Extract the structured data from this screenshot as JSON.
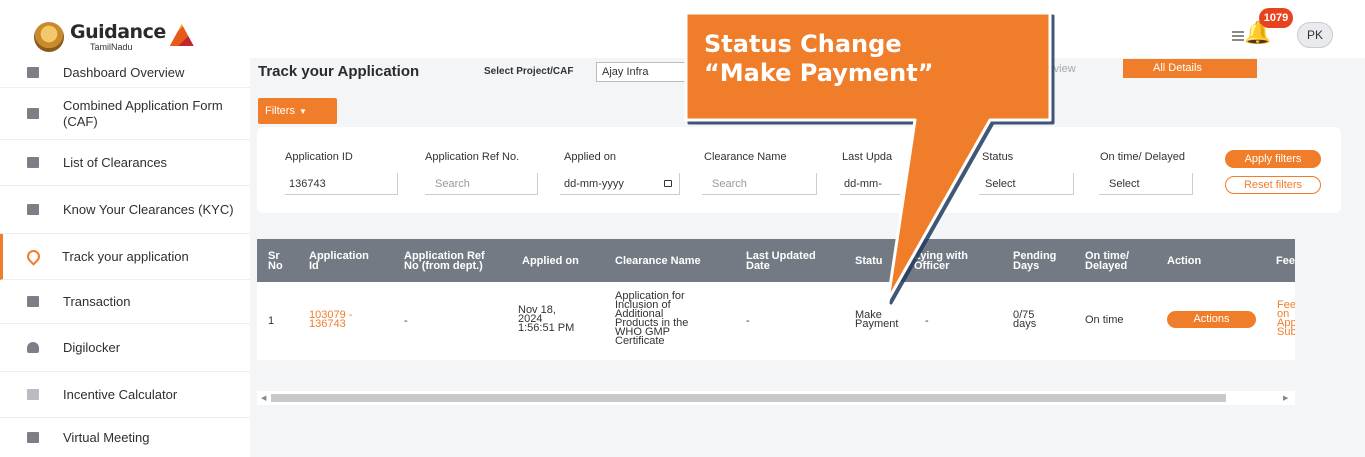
{
  "header": {
    "logo_title": "Guidance",
    "logo_subtitle": "TamilNadu",
    "notification_count": "1079",
    "user_initials": "PK"
  },
  "sidebar": {
    "items": [
      {
        "label": "Dashboard Overview",
        "icon": "dashboard-icon"
      },
      {
        "label": "Combined Application Form (CAF)",
        "icon": "document-icon"
      },
      {
        "label": "List of Clearances",
        "icon": "list-icon"
      },
      {
        "label": "Know Your Clearances (KYC)",
        "icon": "kyc-icon"
      },
      {
        "label": "Track your application",
        "icon": "location-pin-icon",
        "active": true
      },
      {
        "label": "Transaction",
        "icon": "transaction-icon"
      },
      {
        "label": "Digilocker",
        "icon": "cloud-icon"
      },
      {
        "label": "Incentive Calculator",
        "icon": "calculator-icon"
      },
      {
        "label": "Virtual Meeting",
        "icon": "meeting-icon"
      }
    ]
  },
  "main": {
    "title": "Track your Application",
    "project_label": "Select Project/CAF",
    "project_value": "Ajay Infra",
    "overview_tab": "rview",
    "all_details_tab": "All Details",
    "filters_label": "Filters"
  },
  "filters": {
    "application_id": {
      "label": "Application ID",
      "value": "136743"
    },
    "application_ref": {
      "label": "Application Ref No.",
      "placeholder": "Search"
    },
    "applied_on": {
      "label": "Applied on",
      "placeholder": "dd-mm-yyyy"
    },
    "clearance_name": {
      "label": "Clearance Name",
      "placeholder": "Search"
    },
    "last_updated": {
      "label": "Last Upda",
      "placeholder": "dd-mm-"
    },
    "status": {
      "label": "Status",
      "placeholder": "Select"
    },
    "on_time": {
      "label": "On time/ Delayed",
      "placeholder": "Select"
    },
    "apply_label": "Apply filters",
    "reset_label": "Reset filters"
  },
  "table": {
    "headers": [
      {
        "l1": "Sr",
        "l2": "No"
      },
      {
        "l1": "Application",
        "l2": "Id"
      },
      {
        "l1": "Application Ref",
        "l2": "No (from dept.)"
      },
      {
        "l1": "Applied on",
        "l2": ""
      },
      {
        "l1": "Clearance Name",
        "l2": ""
      },
      {
        "l1": "Last Updated",
        "l2": "Date"
      },
      {
        "l1": "Statu",
        "l2": ""
      },
      {
        "l1": "Lying with",
        "l2": "Officer"
      },
      {
        "l1": "Pending",
        "l2": "Days"
      },
      {
        "l1": "On time/",
        "l2": "Delayed"
      },
      {
        "l1": "Action",
        "l2": ""
      },
      {
        "l1": "Fee",
        "l2": ""
      }
    ],
    "row": {
      "sr": "1",
      "app_id_l1": "103079 -",
      "app_id_l2": "136743",
      "ref": "-",
      "applied_l1": "Nov 18,",
      "applied_l2": "2024",
      "applied_l3": "1:56:51 PM",
      "clearance_lines": [
        "Application for",
        "Inclusion of",
        "Additional",
        "Products in the",
        "WHO GMP",
        "Certificate"
      ],
      "last_updated": "-",
      "status_l1": "Make",
      "status_l2": "Payment",
      "lying_with": "-",
      "pending_l1": "0/75",
      "pending_l2": "days",
      "on_time": "On time",
      "action_label": "Actions",
      "fee_lines": [
        "Fee",
        "on",
        "App",
        "Sub"
      ]
    }
  },
  "callout": {
    "line1": "Status Change",
    "line2": "“Make Payment”",
    "color": "#f07d2a"
  }
}
